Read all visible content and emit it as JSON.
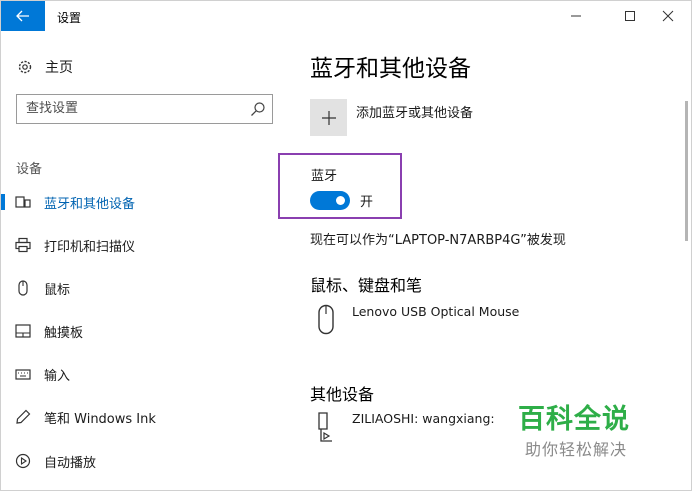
{
  "window": {
    "title": "设置"
  },
  "nav": {
    "home_label": "主页",
    "search_placeholder": "查找设置",
    "section_label": "设备",
    "items": [
      {
        "label": "蓝牙和其他设备",
        "icon": "bluetooth-devices-icon",
        "active": true
      },
      {
        "label": "打印机和扫描仪",
        "icon": "printer-icon",
        "active": false
      },
      {
        "label": "鼠标",
        "icon": "mouse-icon",
        "active": false
      },
      {
        "label": "触摸板",
        "icon": "touchpad-icon",
        "active": false
      },
      {
        "label": "输入",
        "icon": "keyboard-icon",
        "active": false
      },
      {
        "label": "笔和 Windows Ink",
        "icon": "pen-icon",
        "active": false
      },
      {
        "label": "自动播放",
        "icon": "autoplay-icon",
        "active": false
      }
    ]
  },
  "main": {
    "title": "蓝牙和其他设备",
    "add_device_label": "添加蓝牙或其他设备",
    "bluetooth": {
      "label": "蓝牙",
      "toggle_state": "开",
      "on": true
    },
    "discoverable_text": "现在可以作为“LAPTOP-N7ARBP4G”被发现",
    "sections": [
      {
        "title": "鼠标、键盘和笔",
        "devices": [
          {
            "name": "Lenovo USB Optical Mouse",
            "icon": "mouse-icon"
          }
        ]
      },
      {
        "title": "其他设备",
        "devices": [
          {
            "name": "ZILIAOSHI: wangxiang:",
            "icon": "media-device-icon"
          }
        ]
      }
    ]
  },
  "watermark": {
    "line1": "百科全说",
    "line2": "助你轻松解决"
  },
  "colors": {
    "accent": "#0078d7",
    "highlight_box": "#8a3fb0",
    "watermark_green": "#2eae48"
  }
}
